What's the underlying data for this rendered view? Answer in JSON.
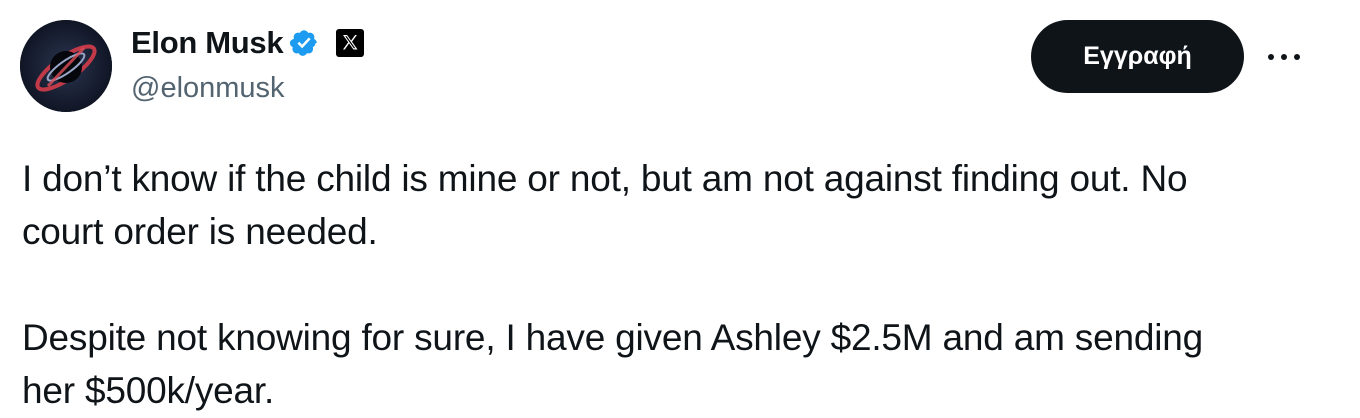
{
  "author": {
    "display_name": "Elon Musk",
    "handle": "@elonmusk",
    "verified_icon": "verified-badge-icon",
    "affiliation_icon": "x-logo-icon",
    "avatar_icon": "avatar-image"
  },
  "actions": {
    "subscribe_label": "Εγγραφή",
    "more_icon": "more-options-icon"
  },
  "colors": {
    "text": "#0f1419",
    "secondary_text": "#536471",
    "verified_blue": "#1d9bf0",
    "button_bg": "#0f1419"
  },
  "tweet": {
    "lines": [
      "I don’t know if the child is mine or not, but am not against finding out. No",
      "court order is needed.",
      "Despite not knowing for sure, I have given Ashley $2.5M and am sending",
      "her $500k/year."
    ]
  }
}
